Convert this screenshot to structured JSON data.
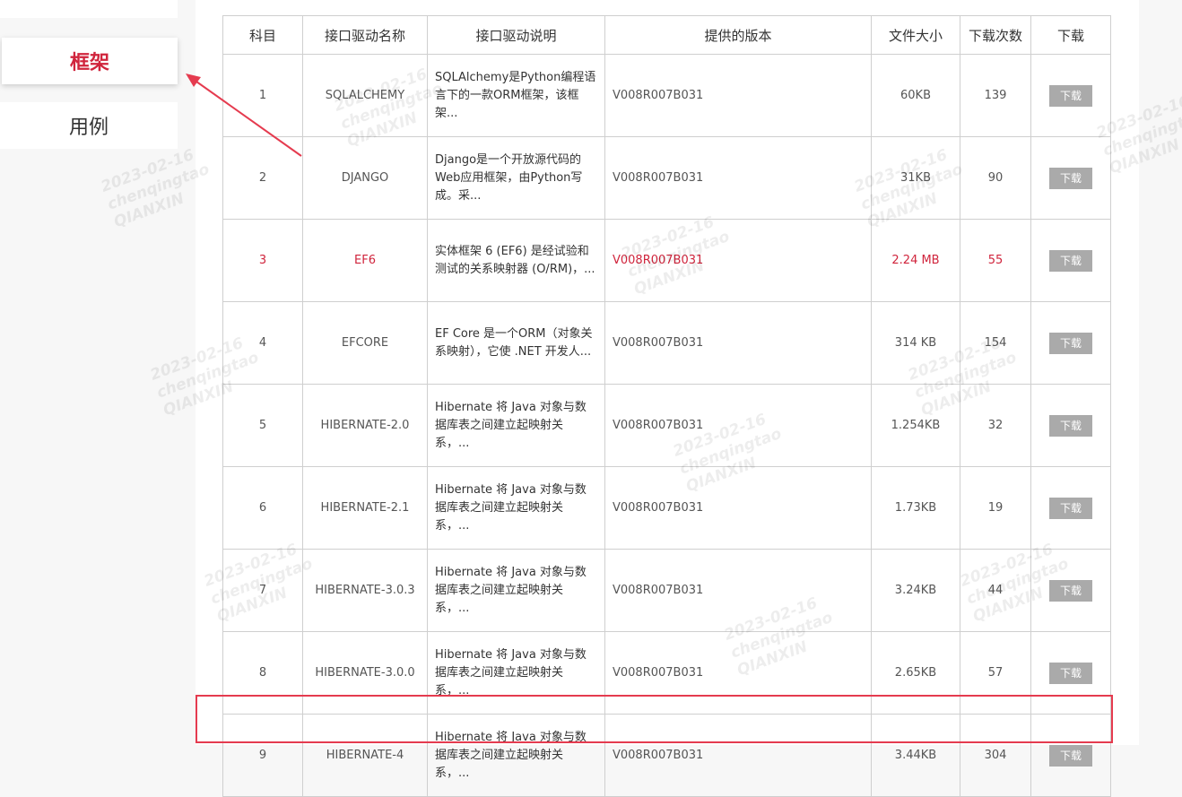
{
  "sidebar": {
    "items": [
      {
        "label": "框架"
      },
      {
        "label": "用例"
      }
    ]
  },
  "table": {
    "headers": [
      "科目",
      "接口驱动名称",
      "接口驱动说明",
      "提供的版本",
      "文件大小",
      "下载次数",
      "下载"
    ],
    "rows": [
      {
        "no": "1",
        "name": "SQLALCHEMY",
        "desc": "SQLAlchemy是Python编程语言下的一款ORM框架，该框架...",
        "version": "V008R007B031",
        "size": "60KB",
        "downloads": "139",
        "action": "下载"
      },
      {
        "no": "2",
        "name": "DJANGO",
        "desc": "Django是一个开放源代码的Web应用框架，由Python写成。采...",
        "version": "V008R007B031",
        "size": "31KB",
        "downloads": "90",
        "action": "下载"
      },
      {
        "no": "3",
        "name": "EF6",
        "desc": "实体框架 6 (EF6) 是经试验和测试的关系映射器 (O/RM)，...",
        "version": "V008R007B031",
        "size": "2.24 MB",
        "downloads": "55",
        "action": "下载"
      },
      {
        "no": "4",
        "name": "EFCORE",
        "desc": "EF Core 是一个ORM（对象关系映射），它使 .NET 开发人...",
        "version": "V008R007B031",
        "size": "314 KB",
        "downloads": "154",
        "action": "下载"
      },
      {
        "no": "5",
        "name": "HIBERNATE-2.0",
        "desc": "Hibernate 将 Java 对象与数据库表之间建立起映射关系，...",
        "version": "V008R007B031",
        "size": "1.254KB",
        "downloads": "32",
        "action": "下载"
      },
      {
        "no": "6",
        "name": "HIBERNATE-2.1",
        "desc": "Hibernate 将 Java 对象与数据库表之间建立起映射关系，...",
        "version": "V008R007B031",
        "size": "1.73KB",
        "downloads": "19",
        "action": "下载"
      },
      {
        "no": "7",
        "name": "HIBERNATE-3.0.3",
        "desc": "Hibernate 将 Java 对象与数据库表之间建立起映射关系，...",
        "version": "V008R007B031",
        "size": "3.24KB",
        "downloads": "44",
        "action": "下载"
      },
      {
        "no": "8",
        "name": "HIBERNATE-3.0.0",
        "desc": "Hibernate 将 Java 对象与数据库表之间建立起映射关系，...",
        "version": "V008R007B031",
        "size": "2.65KB",
        "downloads": "57",
        "action": "下载"
      },
      {
        "no": "9",
        "name": "HIBERNATE-4",
        "desc": "Hibernate 将 Java 对象与数据库表之间建立起映射关系，...",
        "version": "V008R007B031",
        "size": "3.44KB",
        "downloads": "304",
        "action": "下载"
      }
    ]
  },
  "watermark": {
    "lines": [
      "2023-02-16",
      "chenqingtao",
      "QIANXIN"
    ]
  },
  "colors": {
    "accent": "#d0243c",
    "annotation": "#e53b4f",
    "button": "#aaaaaa"
  }
}
